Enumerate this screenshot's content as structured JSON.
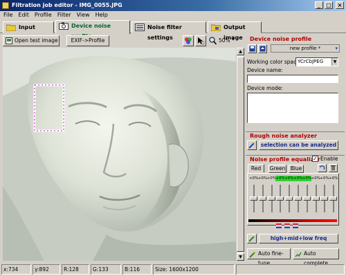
{
  "window": {
    "title": "Filtration job editor - IMG_0055.JPG",
    "controls": {
      "minimize": "_",
      "maximize": "□",
      "close": "×"
    }
  },
  "menu": [
    "File",
    "Edit",
    "Profile",
    "Filter",
    "View",
    "Help"
  ],
  "tabs": [
    {
      "label": "Input image",
      "icon": "folder-icon"
    },
    {
      "label": "Device noise profile",
      "icon": "camera-icon"
    },
    {
      "label": "Noise filter settings",
      "icon": "sliders-icon"
    },
    {
      "label": "Output image",
      "icon": "output-folder-icon"
    }
  ],
  "active_tab_color": "#00662a",
  "toolbar": {
    "open_test_image": "Open test image",
    "exif_profile": "EXIF->Profile",
    "zoom": "50%"
  },
  "device_noise_profile": {
    "title": "Device noise profile",
    "profile_value": "new profile *",
    "working_color_space_label": "Working color space:",
    "working_color_space_value": "YCrCbJPEG",
    "device_name_label": "Device name:",
    "device_name_value": "",
    "device_mode_label": "Device mode:",
    "device_mode_value": ""
  },
  "rough_noise_analyzer": {
    "title": "Rough noise analyzer",
    "status_text": "selection can be analyzed"
  },
  "noise_profile_equalizer": {
    "title": "Noise profile equalizer",
    "enable_label": "Enable",
    "enable_checked": true,
    "channel_tabs": [
      "Red",
      "Green",
      "Blue"
    ],
    "active_channel": "Red",
    "values": [
      "+0%",
      "+0%",
      "+0%",
      "+0%",
      "+0%",
      "+0%",
      "+0%",
      "+0%",
      "+0%",
      "+0%"
    ],
    "slider_levels": [
      0.5,
      0.5,
      0.5,
      0.5,
      0.5,
      0.5,
      0.5,
      0.5,
      0.5,
      0.5
    ],
    "frequency_label": "high+mid+low freq",
    "auto_fine_tune": "Auto fine-tune",
    "auto_complete": "Auto complete"
  },
  "status_bar": {
    "x": "x:734",
    "y": "y:892",
    "r": "R:128",
    "g": "G:133",
    "b": "B:116",
    "size": "Size: 1600x1200"
  },
  "colors": {
    "group_title": "#b00000",
    "analyzer_text": "#1a2a8a",
    "selection_outline": "#ffffff",
    "selection_marching": "#d040d0"
  }
}
